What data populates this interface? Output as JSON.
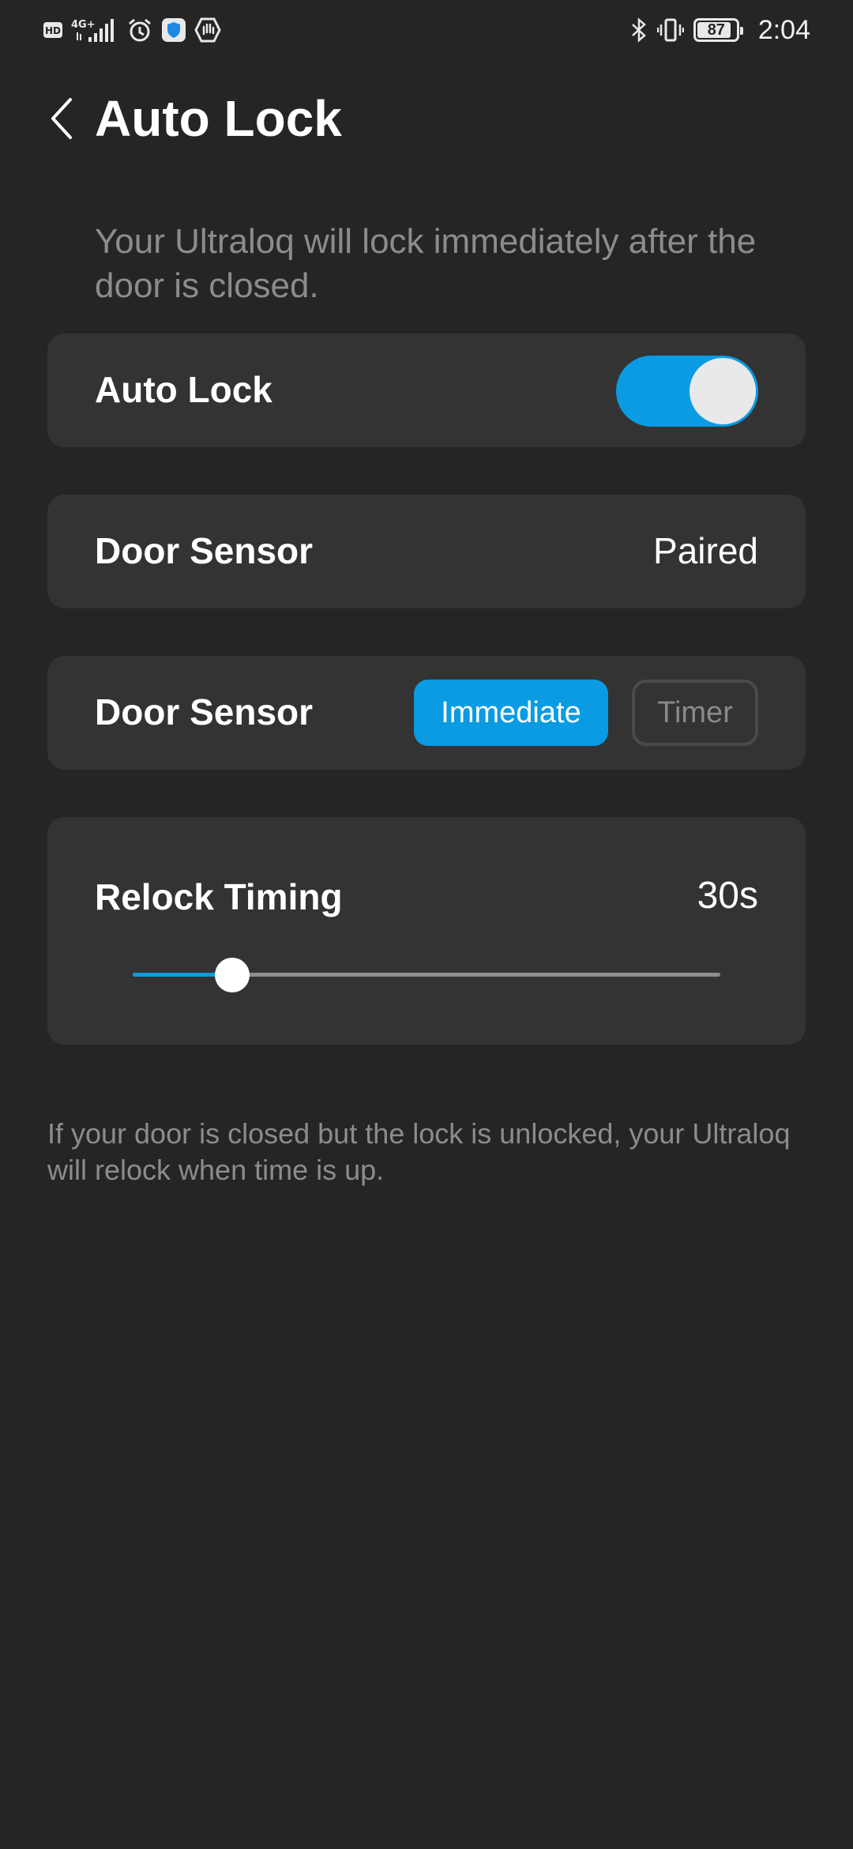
{
  "status_bar": {
    "left_icons": [
      "hd-icon",
      "4g-signal-icon",
      "alarm-icon",
      "shield-app-icon",
      "hand-app-icon"
    ],
    "hd_label": "HD",
    "network_label": "4G+",
    "battery_level": "87",
    "time": "2:04"
  },
  "header": {
    "back_icon": "chevron-left-icon",
    "title": "Auto Lock"
  },
  "intro": "Your Ultraloq will lock immediately after the door is closed.",
  "auto_lock_row": {
    "label": "Auto Lock",
    "toggle_on": true,
    "accent": "#0a9be3"
  },
  "door_sensor_row": {
    "label": "Door Sensor",
    "value": "Paired"
  },
  "door_sensor_mode_row": {
    "label": "Door Sensor",
    "options": [
      "Immediate",
      "Timer"
    ],
    "selected": "Immediate"
  },
  "relock_timing": {
    "label": "Relock Timing",
    "value_label": "30s",
    "slider_fraction": 0.17
  },
  "footnote": "If your door is closed but the lock is unlocked, your Ultraloq will relock when time is up."
}
